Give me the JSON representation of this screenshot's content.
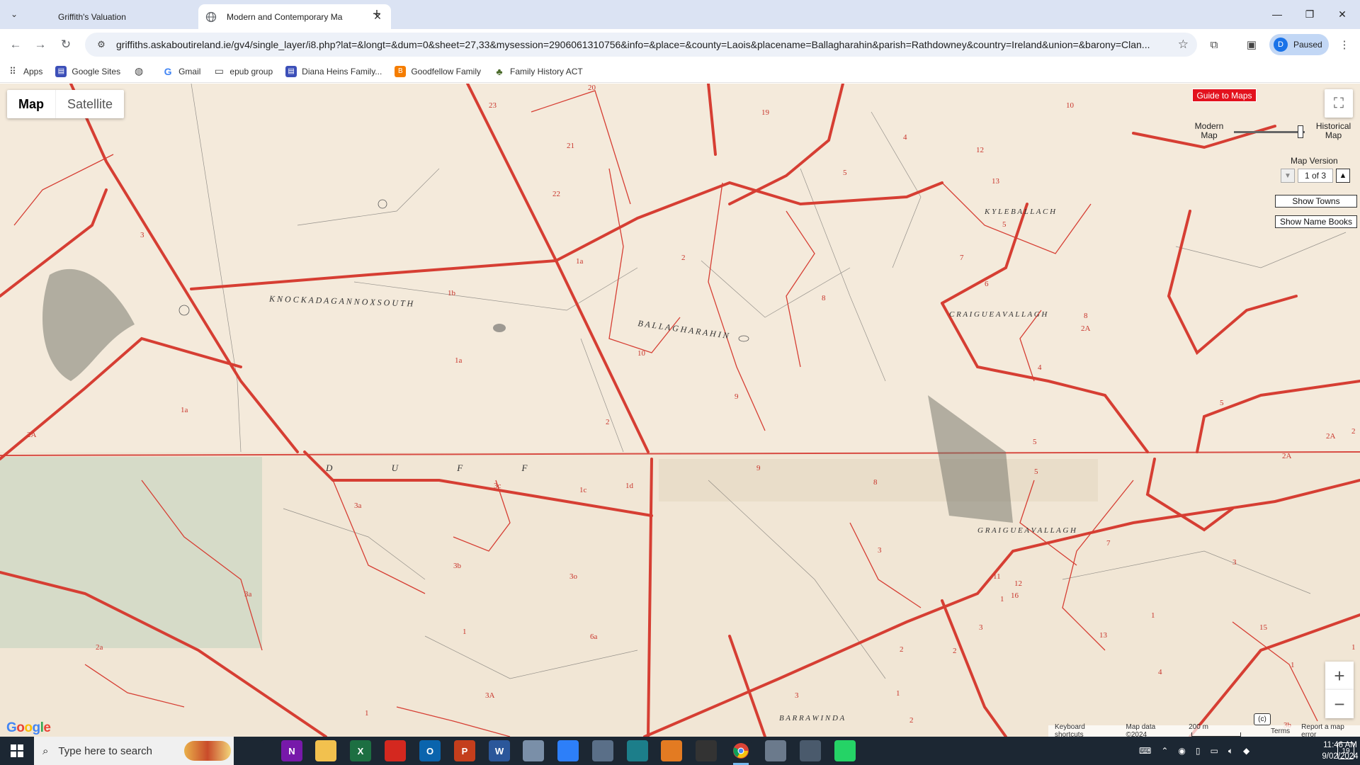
{
  "browser": {
    "tabs": [
      {
        "title": "Griffith's Valuation",
        "active": false
      },
      {
        "title": "Modern and Contemporary Ma",
        "active": true
      }
    ],
    "url": "griffiths.askaboutireland.ie/gv4/single_layer/i8.php?lat=&longt=&dum=0&sheet=27,33&mysession=2906061310756&info=&place=&county=Laois&placename=Ballagharahin&parish=Rathdowney&country=Ireland&union=&barony=Clan...",
    "profile_initial": "D",
    "profile_status": "Paused"
  },
  "bookmarks": [
    {
      "label": "Apps",
      "icon": "apps-grid-icon"
    },
    {
      "label": "Google Sites",
      "icon": "google-sites-icon"
    },
    {
      "label": "",
      "icon": "globe-icon"
    },
    {
      "label": "Gmail",
      "icon": "google-g-icon"
    },
    {
      "label": "epub group",
      "icon": "folder-icon"
    },
    {
      "label": "Diana Heins Family...",
      "icon": "sites-icon"
    },
    {
      "label": "Goodfellow Family",
      "icon": "blogger-icon"
    },
    {
      "label": "Family History ACT",
      "icon": "tree-icon"
    }
  ],
  "map": {
    "type_map": "Map",
    "type_satellite": "Satellite",
    "guide_button": "Guide to Maps",
    "modern_label": "Modern Map",
    "historical_label": "Historical Map",
    "overlay_opacity": 0.9,
    "version_label": "Map Version",
    "version_value": "1 of 3",
    "show_towns": "Show Towns",
    "show_name_books": "Show Name Books",
    "copyright_button": "(c)",
    "attribution": {
      "shortcuts": "Keyboard shortcuts",
      "data": "Map data ©2024",
      "scale": "200 m",
      "terms": "Terms",
      "report": "Report a map error"
    },
    "townlands": [
      "K N O C K A D A G A N N O X   S O U T H",
      "B A L L A G H A R A H I N",
      "C R A I G U E A V A L L A G H",
      "K Y L E B A L L A C H",
      "D U F F",
      "G R A I G U E A V A L L A G H",
      "B A R R A W I N D A"
    ],
    "parcel_labels": [
      "20",
      "23",
      "19",
      "21",
      "22",
      "5",
      "12",
      "10",
      "13",
      "5",
      "7",
      "6",
      "8",
      "1a",
      "2",
      "1b",
      "10",
      "9",
      "1a",
      "2",
      "4",
      "4",
      "2A",
      "3",
      "1a",
      "8",
      "5",
      "3a",
      "3c",
      "1c",
      "1d",
      "9",
      "8",
      "3",
      "7",
      "5",
      "3b",
      "3o",
      "6a",
      "2a",
      "1",
      "3a",
      "3A",
      "1",
      "4",
      "2A",
      "5",
      "2",
      "2",
      "3",
      "1",
      "11",
      "16",
      "12",
      "13",
      "15",
      "1",
      "2",
      "3",
      "1",
      "2",
      "3",
      "1",
      "4",
      "2A",
      "2A",
      "3b",
      "1"
    ]
  },
  "taskbar": {
    "search_placeholder": "Type here to search",
    "apps": [
      {
        "name": "task-view",
        "label": "",
        "color": "#1c2733"
      },
      {
        "name": "onenote",
        "label": "N",
        "color": "#7719aa"
      },
      {
        "name": "file-explorer",
        "label": "",
        "color": "#f2c14e"
      },
      {
        "name": "excel",
        "label": "X",
        "color": "#1d6f42"
      },
      {
        "name": "app-red",
        "label": "",
        "color": "#d4281f"
      },
      {
        "name": "outlook",
        "label": "O",
        "color": "#0a64ad"
      },
      {
        "name": "powerpoint",
        "label": "P",
        "color": "#c43e1c"
      },
      {
        "name": "word",
        "label": "W",
        "color": "#2b579a"
      },
      {
        "name": "app-docs",
        "label": "",
        "color": "#7a8fa8"
      },
      {
        "name": "app-blue",
        "label": "",
        "color": "#2d7ff9"
      },
      {
        "name": "app-photos",
        "label": "",
        "color": "#5a6f88"
      },
      {
        "name": "app-edge",
        "label": "",
        "color": "#1c7e8a"
      },
      {
        "name": "app-media",
        "label": "",
        "color": "#e37b22"
      },
      {
        "name": "app-dark",
        "label": "",
        "color": "#333333"
      },
      {
        "name": "chrome",
        "label": "",
        "color": "#1c2733"
      },
      {
        "name": "app-photo2",
        "label": "",
        "color": "#6b7a8c"
      },
      {
        "name": "app-remote",
        "label": "",
        "color": "#4a5a6c"
      },
      {
        "name": "whatsapp",
        "label": "",
        "color": "#25d366"
      }
    ],
    "time": "11:46 AM",
    "date": "9/02/2024",
    "notification_count": "19"
  }
}
